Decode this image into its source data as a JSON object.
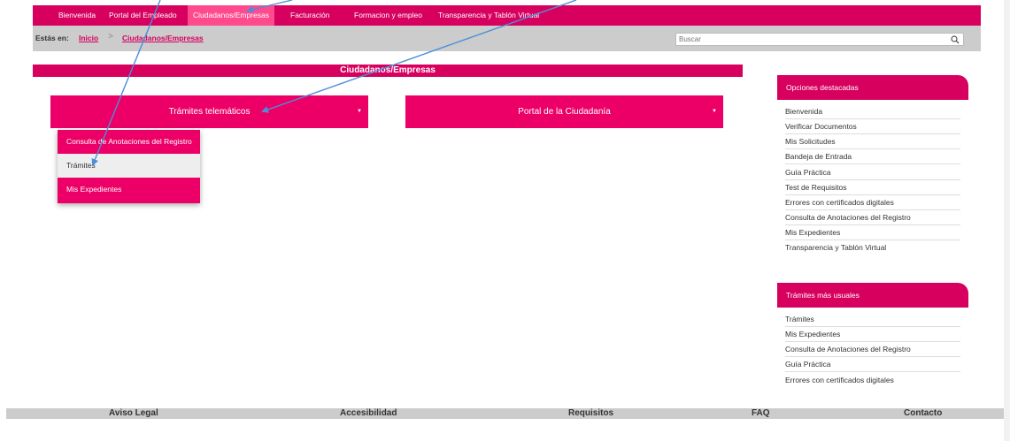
{
  "topnav": {
    "items": [
      {
        "label": "Bienvenida"
      },
      {
        "label": "Portal del Empleado"
      },
      {
        "label": "Ciudadanos/Empresas"
      },
      {
        "label": "Facturación"
      },
      {
        "label": "Formacion y empleo"
      },
      {
        "label": "Transparencia y Tablón Virtual"
      }
    ],
    "active_index": 2
  },
  "breadcrumb": {
    "prefix": "Estás en:",
    "items": [
      "Inicio",
      "Ciudadanos/Empresas"
    ],
    "separator": ">"
  },
  "search": {
    "placeholder": "Buscar",
    "icon": "search-icon"
  },
  "page": {
    "title": "Ciudadanos/Empresas"
  },
  "menu_buttons": [
    {
      "label": "Trámites telemáticos",
      "caret": "▼"
    },
    {
      "label": "Portal de la Ciudadanía",
      "caret": "▼"
    }
  ],
  "dropdown": {
    "items": [
      {
        "label": "Consulta de Anotaciones del Registro"
      },
      {
        "label": "Trámites"
      },
      {
        "label": "Mis Expedientes"
      }
    ],
    "hovered_index": 1
  },
  "sidebar": {
    "featured": {
      "title": "Opciones destacadas",
      "links": [
        "Bienvenida",
        "Verificar Documentos",
        "Mis Solicitudes",
        "Bandeja de Entrada",
        "Guía Práctica",
        "Test de Requisitos",
        "Errores con certificados digitales",
        "Consulta de Anotaciones del Registro",
        "Mis Expedientes",
        "Transparencia y Tablón Virtual"
      ]
    },
    "common": {
      "title": "Trámites más usuales",
      "links": [
        "Trámites",
        "Mis Expedientes",
        "Consulta de Anotaciones del Registro",
        "Guía Práctica",
        "Errores con certificados digitales"
      ]
    }
  },
  "footer": {
    "links": [
      "Aviso Legal",
      "Accesibilidad",
      "Requisitos",
      "FAQ",
      "Contacto"
    ]
  },
  "colors": {
    "brand": "#d7005f",
    "button": "#ec0067",
    "active_tab": "#ff4a8d",
    "annotation_arrow": "#4a90d9"
  }
}
